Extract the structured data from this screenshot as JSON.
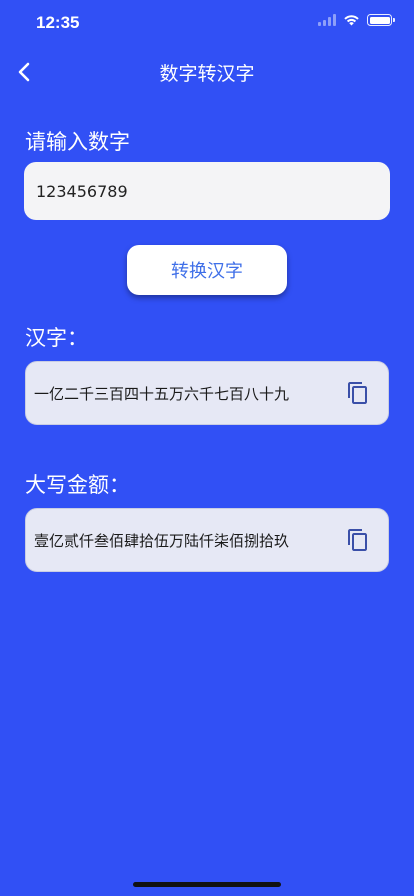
{
  "status_bar": {
    "time": "12:35"
  },
  "nav": {
    "title": "数字转汉字"
  },
  "input_section": {
    "label": "请输入数字",
    "value": "123456789"
  },
  "convert_button": {
    "label": "转换汉字"
  },
  "chinese_section": {
    "label": "汉字：",
    "result": "一亿二千三百四十五万六千七百八十九",
    "copy_icon": "copy-icon"
  },
  "capital_section": {
    "label": "大写金额：",
    "result": "壹亿贰仟叁佰肆拾伍万陆仟柒佰捌拾玖",
    "copy_icon": "copy-icon"
  },
  "colors": {
    "background": "#3150f5",
    "button_text": "#3f6fe8"
  }
}
